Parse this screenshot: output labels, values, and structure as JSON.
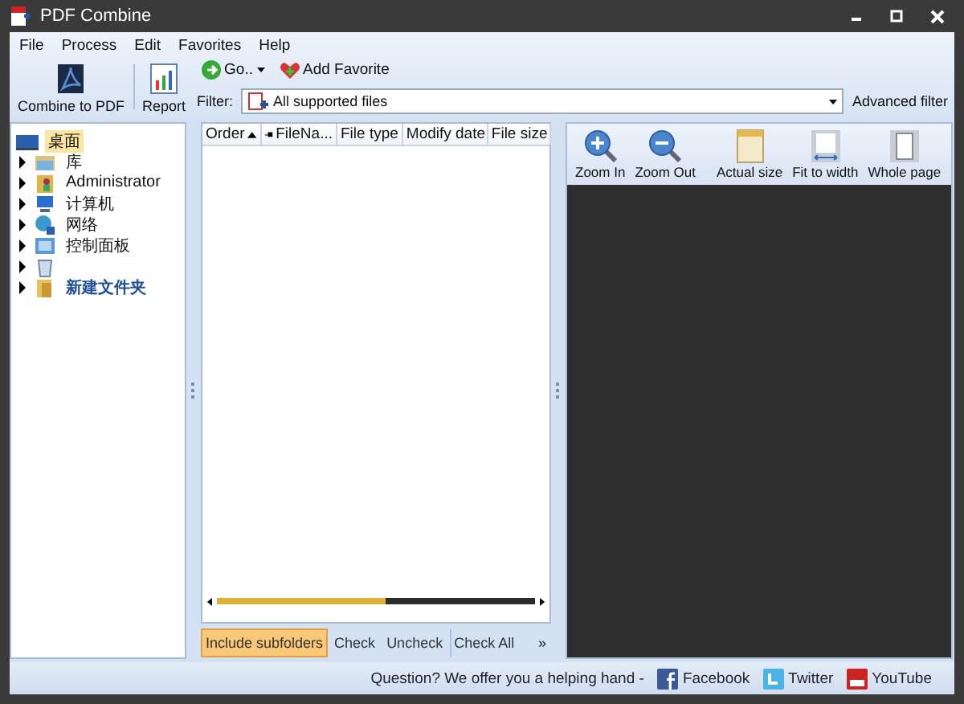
{
  "window": {
    "title": "PDF Combine"
  },
  "menu": [
    "File",
    "Process",
    "Edit",
    "Favorites",
    "Help"
  ],
  "toolbar": {
    "buttons": [
      {
        "label": "Combine to PDF",
        "kind": "pdf"
      },
      {
        "label": "Report",
        "kind": "report"
      }
    ],
    "go": "Go..",
    "add_favorite": "Add Favorite",
    "filter_label": "Filter:",
    "filter_value": "All supported files",
    "advanced_filter": "Advanced filter"
  },
  "tree": {
    "label": "桌面",
    "selected": true,
    "children": [
      {
        "label": "库",
        "kind": "library",
        "expanded": false
      },
      {
        "label": "Administrator",
        "kind": "user",
        "expanded": false
      },
      {
        "label": "计算机",
        "kind": "computer",
        "expanded": false
      },
      {
        "label": "网络",
        "kind": "network",
        "expanded": false
      },
      {
        "label": "控制面板",
        "kind": "panel",
        "expanded": false
      },
      {
        "kind": "recycle",
        "expanded": false
      },
      {
        "label": "新建文件夹",
        "kind": "folder",
        "expanded": false
      }
    ]
  },
  "file_list": {
    "columns": [
      {
        "label": "Order",
        "sorted": true
      },
      {
        "label": "FileNa...",
        "sorted": false
      },
      {
        "label": "File type",
        "sorted": false
      },
      {
        "label": "Modify date",
        "sorted": false
      },
      {
        "label": "File size",
        "sorted": false
      }
    ],
    "buttons": [
      {
        "label": "Include subfolders",
        "on": true
      },
      {
        "label": "Check",
        "on": false
      },
      {
        "label": "Uncheck",
        "on": false
      },
      {
        "label": "Check All",
        "on": false
      }
    ],
    "more": "»"
  },
  "preview": {
    "tools": [
      {
        "label": "Zoom In",
        "kind": "zoom-in"
      },
      {
        "label": "Zoom Out",
        "kind": "zoom-out"
      },
      {
        "label": "Actual size",
        "kind": "actual"
      },
      {
        "label": "Fit to width",
        "kind": "fit"
      },
      {
        "label": "Whole page",
        "kind": "page"
      }
    ]
  },
  "status_bar": {
    "text": "Question? We offer you a helping hand -",
    "links": [
      {
        "label": "Facebook",
        "kind": "facebook"
      },
      {
        "label": "Twitter",
        "kind": "twitter"
      },
      {
        "label": "YouTube",
        "kind": "youtube"
      }
    ]
  }
}
